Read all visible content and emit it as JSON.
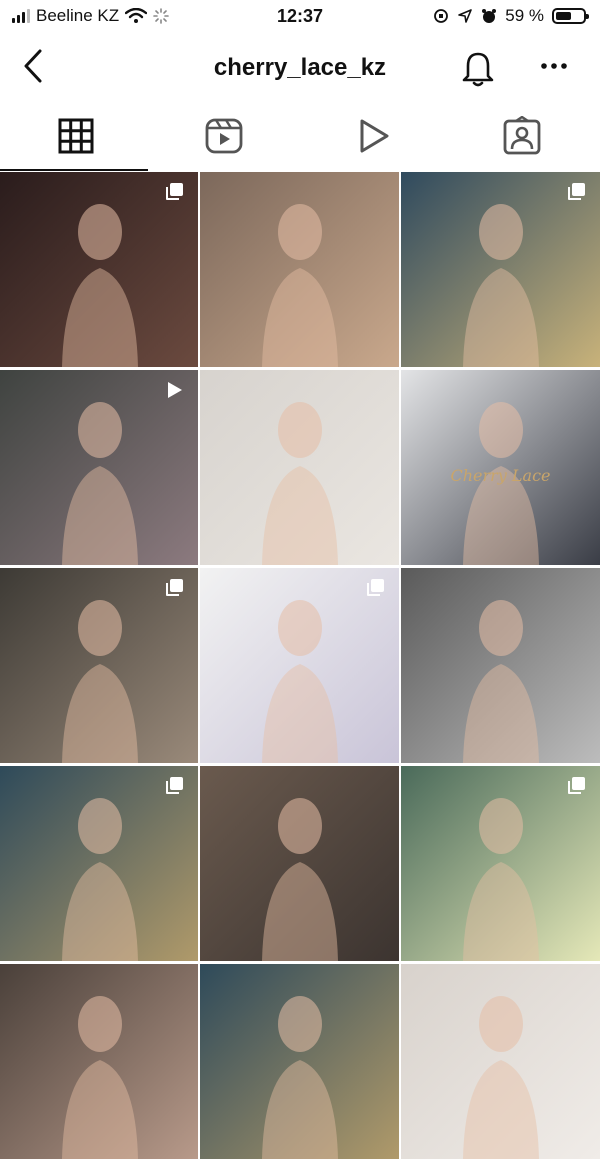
{
  "status_bar": {
    "carrier": "Beeline KZ",
    "time": "12:37",
    "battery_percent": "59 %",
    "battery_level": 0.59
  },
  "header": {
    "username": "cherry_lace_kz",
    "back_icon": "chevron-left-icon",
    "bell_icon": "bell-icon",
    "more_icon": "ellipsis-icon"
  },
  "tabs": [
    {
      "name": "grid",
      "icon": "grid-icon",
      "active": true
    },
    {
      "name": "reels",
      "icon": "reels-icon",
      "active": false
    },
    {
      "name": "videos",
      "icon": "play-icon",
      "active": false
    },
    {
      "name": "tagged",
      "icon": "tagged-person-icon",
      "active": false
    }
  ],
  "grid": {
    "posts": [
      {
        "type": "carousel",
        "colors": [
          "#2a1c1c",
          "#6b4a3f"
        ]
      },
      {
        "type": "photo",
        "colors": [
          "#7c685b",
          "#c9a88c"
        ]
      },
      {
        "type": "carousel",
        "colors": [
          "#2f4a5e",
          "#c8b27a"
        ]
      },
      {
        "type": "video",
        "colors": [
          "#3f4340",
          "#8c7a7f"
        ]
      },
      {
        "type": "photo",
        "colors": [
          "#d7d3ce",
          "#eae6e1"
        ]
      },
      {
        "type": "photo",
        "colors": [
          "#e3e4e6",
          "#3a3d46"
        ],
        "caption": "Cherry Lace"
      },
      {
        "type": "carousel",
        "colors": [
          "#3d3a35",
          "#9a8a7a"
        ]
      },
      {
        "type": "carousel",
        "colors": [
          "#f2f2f2",
          "#c9c4d8"
        ]
      },
      {
        "type": "photo",
        "colors": [
          "#5a5a5a",
          "#bcbcbc"
        ]
      },
      {
        "type": "carousel",
        "colors": [
          "#2e4a5a",
          "#b09a6a"
        ]
      },
      {
        "type": "photo",
        "colors": [
          "#6a5a4e",
          "#3c3430"
        ]
      },
      {
        "type": "carousel",
        "colors": [
          "#4a6a5a",
          "#e5e8b8"
        ]
      },
      {
        "type": "photo",
        "colors": [
          "#4a403a",
          "#b89a8a"
        ]
      },
      {
        "type": "photo",
        "colors": [
          "#2e4a5a",
          "#b09a6a"
        ]
      },
      {
        "type": "photo",
        "colors": [
          "#d8d2cc",
          "#f0ece8"
        ]
      }
    ]
  }
}
